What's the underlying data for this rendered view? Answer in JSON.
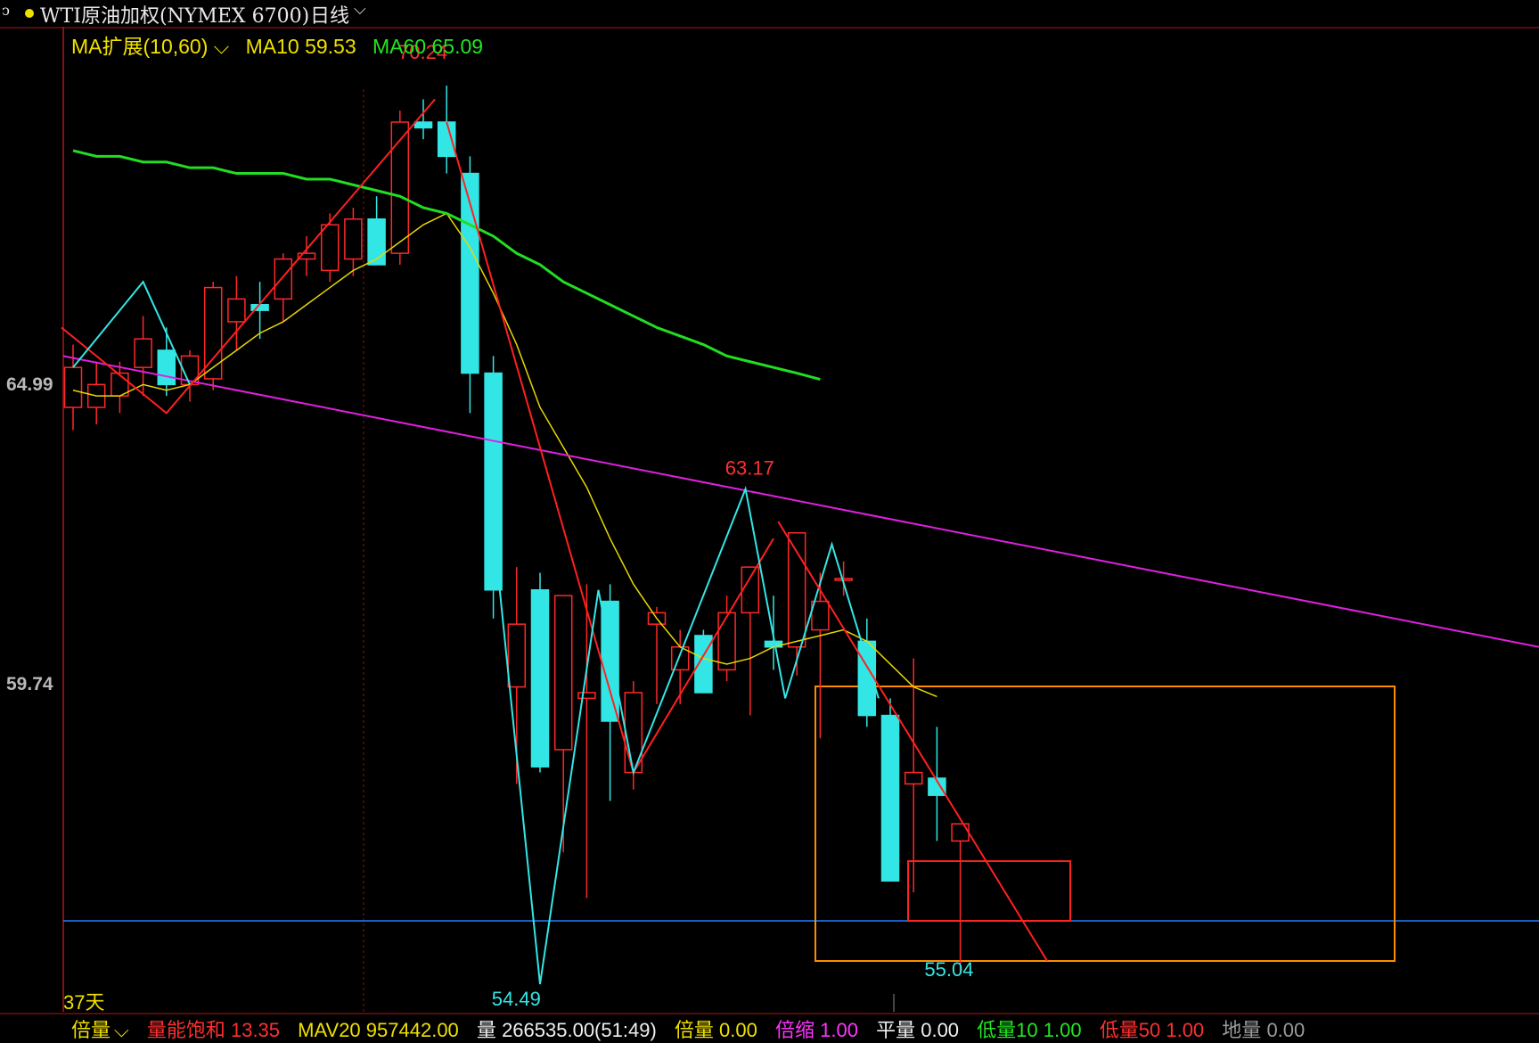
{
  "header": {
    "bracket_glyph": "ↄ",
    "title": "WTI原油加权(NYMEX 6700)",
    "period": "日线",
    "period_chevron": "⌵"
  },
  "ma_legend": {
    "extension_label": "MA扩展(10,60)",
    "chevron": "⌵",
    "ma10_label": "MA10 59.53",
    "ma60_label": "MA60 65.09"
  },
  "y_axis": {
    "labels": [
      "64.99",
      "59.74"
    ]
  },
  "days_label": "37天",
  "bottom_bar": {
    "mode_label": "倍量",
    "chevron": "⌵",
    "items": [
      {
        "label": "量能饱和",
        "value": "13.35"
      },
      {
        "label": "MAV20",
        "value": "957442.00"
      },
      {
        "label": "量",
        "value": "266535.00(51:49)"
      },
      {
        "label": "倍量",
        "value": "0.00"
      },
      {
        "label": "倍缩",
        "value": "1.00"
      },
      {
        "label": "平量",
        "value": "0.00"
      },
      {
        "label": "低量10",
        "value": "1.00"
      },
      {
        "label": "低量50",
        "value": "1.00"
      },
      {
        "label": "地量",
        "value": "0.00"
      }
    ]
  },
  "chart_data": {
    "type": "candlestick",
    "y_range": [
      53.6,
      71.6
    ],
    "y_ticks": [
      64.99,
      59.74
    ],
    "annotations": [
      {
        "text": "70.24",
        "value": 70.24,
        "bar": 15,
        "color": "#ff3030"
      },
      {
        "text": "63.17",
        "value": 63.17,
        "bar": 29,
        "color": "#ff3030"
      },
      {
        "text": "54.49",
        "value": 54.49,
        "bar": 19,
        "color": "#33e6e6"
      },
      {
        "text": "55.04",
        "value": 55.04,
        "bar": 37,
        "color": "#33e6e6"
      }
    ],
    "candles": [
      {
        "o": 64.6,
        "h": 65.7,
        "l": 64.2,
        "c": 65.3
      },
      {
        "o": 64.6,
        "h": 65.4,
        "l": 64.3,
        "c": 65.0
      },
      {
        "o": 64.8,
        "h": 65.4,
        "l": 64.5,
        "c": 65.2
      },
      {
        "o": 65.3,
        "h": 66.2,
        "l": 64.8,
        "c": 65.8
      },
      {
        "o": 65.6,
        "h": 66.0,
        "l": 64.8,
        "c": 65.0
      },
      {
        "o": 65.0,
        "h": 65.6,
        "l": 64.7,
        "c": 65.5
      },
      {
        "o": 65.1,
        "h": 66.8,
        "l": 64.9,
        "c": 66.7
      },
      {
        "o": 66.1,
        "h": 66.9,
        "l": 65.6,
        "c": 66.5
      },
      {
        "o": 66.4,
        "h": 66.8,
        "l": 65.8,
        "c": 66.3
      },
      {
        "o": 66.5,
        "h": 67.3,
        "l": 66.1,
        "c": 67.2
      },
      {
        "o": 67.2,
        "h": 67.6,
        "l": 66.9,
        "c": 67.3
      },
      {
        "o": 67.0,
        "h": 68.0,
        "l": 66.8,
        "c": 67.8
      },
      {
        "o": 67.2,
        "h": 68.1,
        "l": 66.9,
        "c": 67.9
      },
      {
        "o": 67.9,
        "h": 68.3,
        "l": 67.1,
        "c": 67.1
      },
      {
        "o": 67.3,
        "h": 69.8,
        "l": 67.1,
        "c": 69.6
      },
      {
        "o": 69.6,
        "h": 70.0,
        "l": 69.3,
        "c": 69.5
      },
      {
        "o": 69.6,
        "h": 70.24,
        "l": 68.7,
        "c": 69.0
      },
      {
        "o": 68.7,
        "h": 69.0,
        "l": 64.5,
        "c": 65.2
      },
      {
        "o": 65.2,
        "h": 65.5,
        "l": 60.9,
        "c": 61.4
      },
      {
        "o": 59.7,
        "h": 61.8,
        "l": 58.0,
        "c": 60.8
      },
      {
        "o": 61.4,
        "h": 61.7,
        "l": 58.2,
        "c": 58.3
      },
      {
        "o": 58.6,
        "h": 61.3,
        "l": 56.8,
        "c": 61.3
      },
      {
        "o": 59.5,
        "h": 61.5,
        "l": 56.0,
        "c": 59.6
      },
      {
        "o": 61.2,
        "h": 61.5,
        "l": 57.7,
        "c": 59.1
      },
      {
        "o": 58.2,
        "h": 59.8,
        "l": 57.9,
        "c": 59.6
      },
      {
        "o": 60.8,
        "h": 61.1,
        "l": 59.4,
        "c": 61.0
      },
      {
        "o": 60.0,
        "h": 60.7,
        "l": 59.4,
        "c": 60.4
      },
      {
        "o": 60.6,
        "h": 60.7,
        "l": 59.7,
        "c": 59.6
      },
      {
        "o": 60.0,
        "h": 61.3,
        "l": 59.8,
        "c": 61.0
      },
      {
        "o": 61.0,
        "h": 61.8,
        "l": 59.2,
        "c": 61.8
      },
      {
        "o": 60.5,
        "h": 61.3,
        "l": 60.0,
        "c": 60.4
      },
      {
        "o": 60.4,
        "h": 62.4,
        "l": 59.9,
        "c": 62.4
      },
      {
        "o": 60.7,
        "h": 61.7,
        "l": 58.8,
        "c": 61.2
      },
      {
        "o": 61.6,
        "h": 61.9,
        "l": 61.3,
        "c": 61.6
      },
      {
        "o": 60.5,
        "h": 60.9,
        "l": 59.0,
        "c": 59.2
      },
      {
        "o": 59.2,
        "h": 59.5,
        "l": 56.7,
        "c": 56.3
      },
      {
        "o": 58.0,
        "h": 60.2,
        "l": 56.1,
        "c": 58.2
      },
      {
        "o": 58.1,
        "h": 59.0,
        "l": 57.0,
        "c": 57.8
      },
      {
        "o": 57.0,
        "h": 57.3,
        "l": 54.7,
        "c": 57.3
      }
    ],
    "ma10": [
      64.9,
      64.8,
      64.8,
      65.0,
      64.9,
      65.0,
      65.3,
      65.6,
      65.9,
      66.1,
      66.4,
      66.7,
      67.0,
      67.2,
      67.5,
      67.8,
      68.0,
      67.4,
      66.6,
      65.7,
      64.6,
      63.9,
      63.2,
      62.3,
      61.5,
      60.9,
      60.4,
      60.2,
      60.1,
      60.2,
      60.4,
      60.5,
      60.6,
      60.7,
      60.5,
      60.1,
      59.7,
      59.53
    ],
    "ma60": [
      69.1,
      69.0,
      69.0,
      68.9,
      68.9,
      68.8,
      68.8,
      68.7,
      68.7,
      68.7,
      68.6,
      68.6,
      68.5,
      68.4,
      68.3,
      68.1,
      68.0,
      67.8,
      67.6,
      67.3,
      67.1,
      66.8,
      66.6,
      66.4,
      66.2,
      66.0,
      65.85,
      65.7,
      65.5,
      65.4,
      65.3,
      65.2,
      65.09
    ],
    "horizontal_line": 55.6
  }
}
